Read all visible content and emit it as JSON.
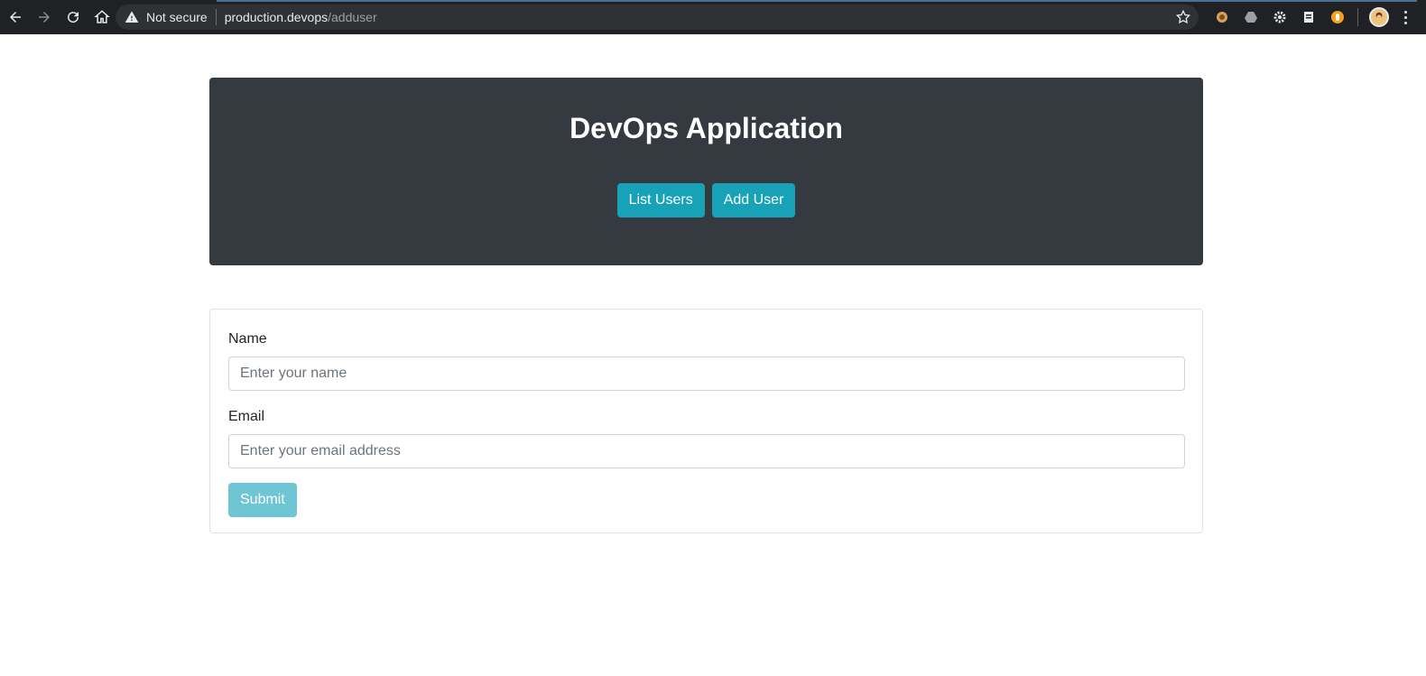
{
  "browser": {
    "security_label": "Not secure",
    "url_host": "production.devops",
    "url_path": "/adduser",
    "icons": [
      "back-icon",
      "forward-icon",
      "reload-icon",
      "home-icon",
      "warning-icon",
      "bookmark-star-icon",
      "extension-icon",
      "drive-icon",
      "gear-icon",
      "document-icon",
      "hand-icon",
      "avatar-icon",
      "menu-icon"
    ]
  },
  "header": {
    "title": "DevOps Application",
    "buttons": {
      "list_users": "List Users",
      "add_user": "Add User"
    }
  },
  "form": {
    "name_label": "Name",
    "name_placeholder": "Enter your name",
    "email_label": "Email",
    "email_placeholder": "Enter your email address",
    "submit_label": "Submit"
  },
  "colors": {
    "jumbotron": "#343a40",
    "button_info": "#17a2b8",
    "button_submit_disabled": "#6ec6d4"
  }
}
